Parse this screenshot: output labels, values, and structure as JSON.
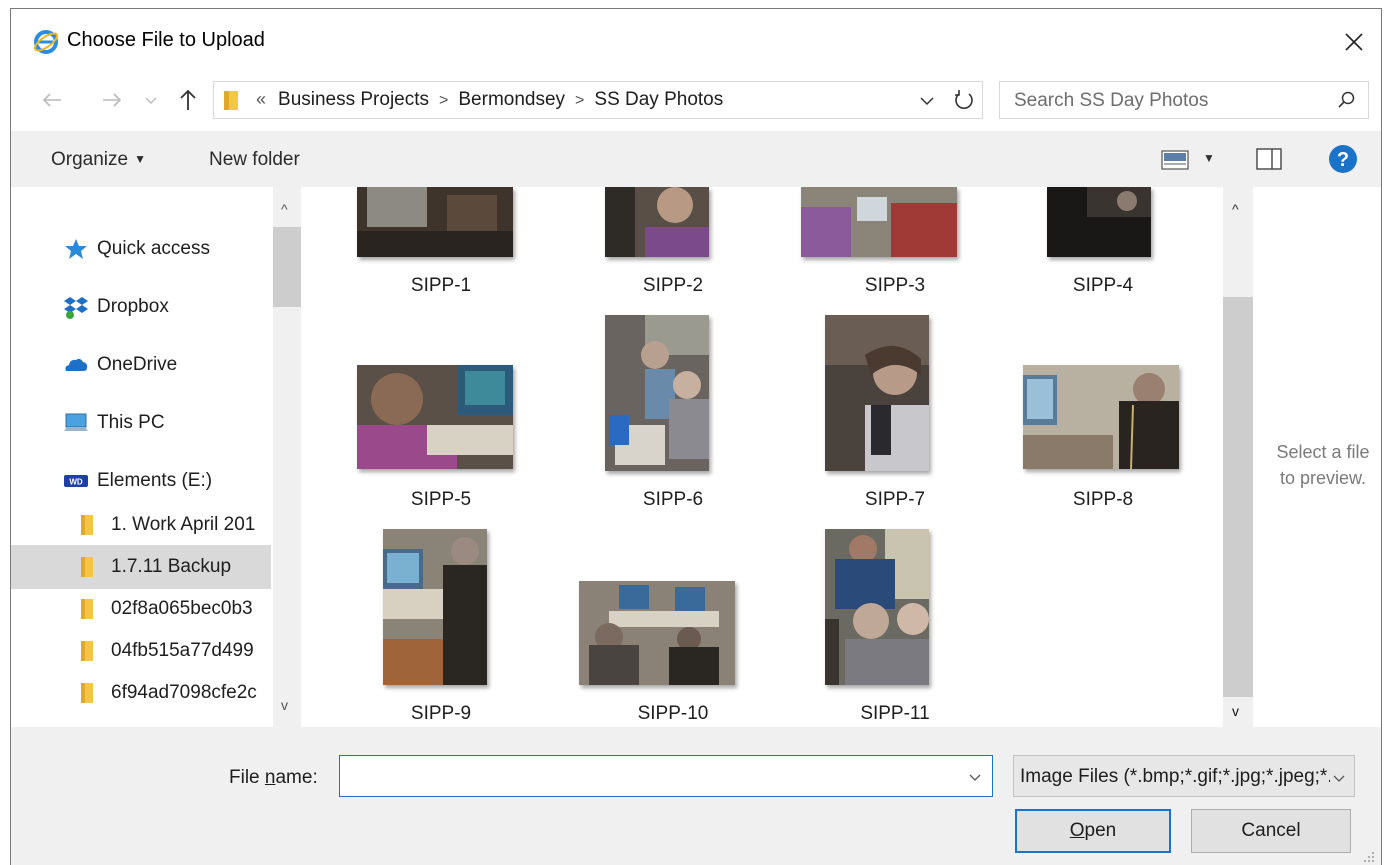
{
  "window": {
    "title": "Choose File to Upload",
    "close_icon": "close-icon"
  },
  "address": {
    "overflow": "«",
    "crumbs": [
      "Business Projects",
      "Bermondsey",
      "SS Day Photos"
    ],
    "separator": ">"
  },
  "search": {
    "placeholder": "Search SS Day Photos"
  },
  "toolbar": {
    "organize_label": "Organize",
    "new_folder_label": "New folder"
  },
  "nav": {
    "items": [
      {
        "label": "Quick access",
        "icon": "star-icon"
      },
      {
        "label": "Dropbox",
        "icon": "dropbox-icon"
      },
      {
        "label": "OneDrive",
        "icon": "onedrive-icon"
      },
      {
        "label": "This PC",
        "icon": "computer-icon"
      },
      {
        "label": "Elements (E:)",
        "icon": "drive-icon"
      }
    ],
    "folders": [
      {
        "label": "1. Work April 201"
      },
      {
        "label": "1.7.11 Backup",
        "selected": true
      },
      {
        "label": "02f8a065bec0b3"
      },
      {
        "label": "04fb515a77d499"
      },
      {
        "label": "6f94ad7098cfe2c"
      }
    ]
  },
  "files": [
    {
      "name": "SIPP-1"
    },
    {
      "name": "SIPP-2"
    },
    {
      "name": "SIPP-3"
    },
    {
      "name": "SIPP-4"
    },
    {
      "name": "SIPP-5"
    },
    {
      "name": "SIPP-6"
    },
    {
      "name": "SIPP-7"
    },
    {
      "name": "SIPP-8"
    },
    {
      "name": "SIPP-9"
    },
    {
      "name": "SIPP-10"
    },
    {
      "name": "SIPP-11"
    }
  ],
  "preview": {
    "line1": "Select a file",
    "line2": "to preview."
  },
  "footer": {
    "file_name_label_pre": "File ",
    "file_name_label_key": "n",
    "file_name_label_post": "ame:",
    "file_name_value": "",
    "file_type": "Image Files (*.bmp;*.gif;*.jpg;*.jpeg;*.png)",
    "open_key": "O",
    "open_rest": "pen",
    "cancel_label": "Cancel"
  },
  "colors": {
    "accent": "#1a73c8",
    "help": "#1a73c8",
    "folder": "#f3c645"
  }
}
